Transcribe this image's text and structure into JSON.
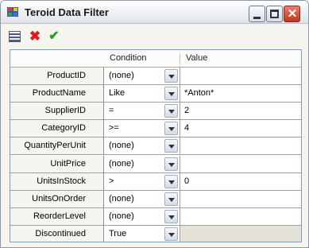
{
  "window": {
    "title": "Teroid Data Filter"
  },
  "columns": {
    "condition": "Condition",
    "value": "Value"
  },
  "rows": [
    {
      "name": "ProductID",
      "condition": "(none)",
      "value": ""
    },
    {
      "name": "ProductName",
      "condition": "Like",
      "value": "*Anton*"
    },
    {
      "name": "SupplierID",
      "condition": "=",
      "value": "2"
    },
    {
      "name": "CategoryID",
      "condition": ">=",
      "value": "4"
    },
    {
      "name": "QuantityPerUnit",
      "condition": "(none)",
      "value": ""
    },
    {
      "name": "UnitPrice",
      "condition": "(none)",
      "value": ""
    },
    {
      "name": "UnitsInStock",
      "condition": ">",
      "value": "0"
    },
    {
      "name": "UnitsOnOrder",
      "condition": "(none)",
      "value": ""
    },
    {
      "name": "ReorderLevel",
      "condition": "(none)",
      "value": ""
    },
    {
      "name": "Discontinued",
      "condition": "True",
      "value": ""
    }
  ],
  "toolbar": {
    "icons": [
      "list-icon",
      "delete-icon",
      "accept-icon"
    ]
  },
  "colors": {
    "delete": "#e21a1a",
    "accept": "#25a325",
    "disabled_cell": "#e4e2d9"
  }
}
